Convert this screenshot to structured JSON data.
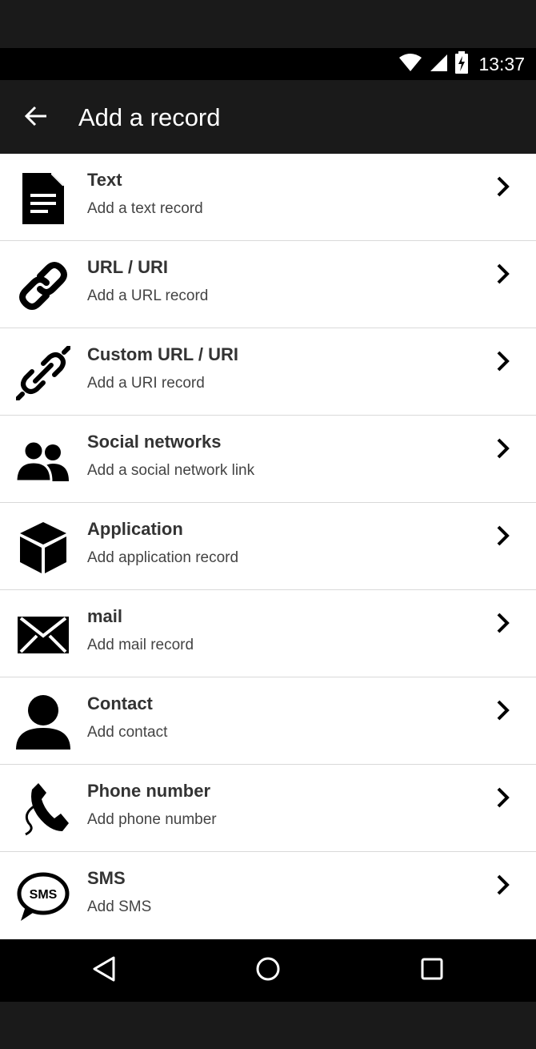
{
  "status_bar": {
    "time": "13:37",
    "icons": [
      "wifi-icon",
      "cell-signal-icon",
      "battery-charging-icon"
    ]
  },
  "app_bar": {
    "title": "Add a record",
    "back_icon": "arrow-left-icon"
  },
  "records": [
    {
      "id": "text",
      "icon": "document-icon",
      "title": "Text",
      "subtitle": "Add a text record"
    },
    {
      "id": "url",
      "icon": "link-icon",
      "title": "URL / URI",
      "subtitle": "Add a URL record"
    },
    {
      "id": "custom-url",
      "icon": "broken-link-icon",
      "title": "Custom URL / URI",
      "subtitle": "Add a URI record"
    },
    {
      "id": "social",
      "icon": "people-icon",
      "title": "Social networks",
      "subtitle": "Add a social network link"
    },
    {
      "id": "application",
      "icon": "cube-icon",
      "title": "Application",
      "subtitle": "Add application record"
    },
    {
      "id": "mail",
      "icon": "envelope-icon",
      "title": "mail",
      "subtitle": "Add mail record"
    },
    {
      "id": "contact",
      "icon": "person-icon",
      "title": "Contact",
      "subtitle": "Add contact"
    },
    {
      "id": "phone",
      "icon": "phone-icon",
      "title": "Phone number",
      "subtitle": "Add phone number"
    },
    {
      "id": "sms",
      "icon": "sms-bubble-icon",
      "title": "SMS",
      "subtitle": "Add SMS"
    }
  ],
  "nav_bar": {
    "buttons": [
      "back-triangle-icon",
      "home-circle-icon",
      "recents-square-icon"
    ]
  },
  "colors": {
    "app_bar": "#1a1a1a",
    "status_bar": "#000000",
    "list_background": "#ffffff",
    "divider": "#d9d9d9",
    "title_text": "#333333"
  }
}
